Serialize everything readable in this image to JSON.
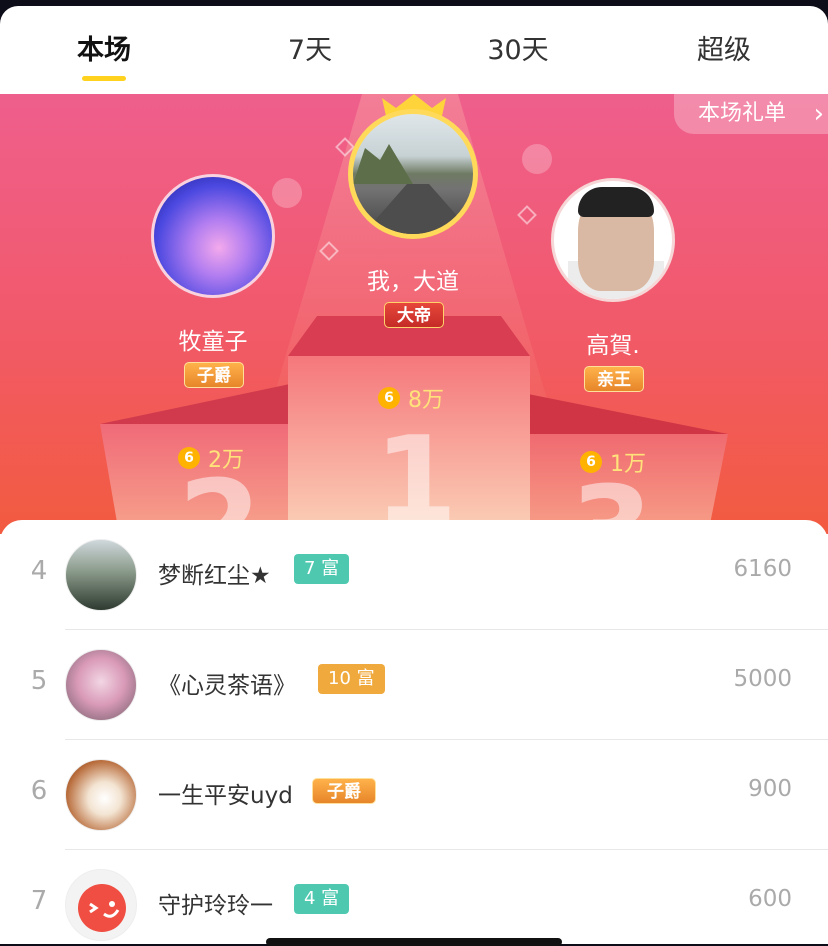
{
  "tabs": [
    "本场",
    "7天",
    "30天",
    "超级"
  ],
  "gift_link": "本场礼单",
  "podium": {
    "first": {
      "name": "我，大道",
      "title": "大帝",
      "value": "8万",
      "rank": "1"
    },
    "second": {
      "name": "牧童子",
      "title": "子爵",
      "value": "2万",
      "rank": "2"
    },
    "third": {
      "name": "高賀.",
      "title": "亲王",
      "value": "1万",
      "rank": "3"
    }
  },
  "coin_symbol": "6",
  "ranking": [
    {
      "rank": "4",
      "name": "梦断红尘★",
      "level": "7 富",
      "score": "6160"
    },
    {
      "rank": "5",
      "name": "《心灵茶语》",
      "level": "10 富",
      "score": "5000"
    },
    {
      "rank": "6",
      "name": "一生平安uyd",
      "level": "子爵",
      "score": "900"
    },
    {
      "rank": "7",
      "name": "守护玲玲一",
      "level": "4 富",
      "score": "600"
    }
  ],
  "colors": {
    "accent": "#ffd21f",
    "hero_top": "#ef5f8d",
    "hero_bottom": "#f25b3f",
    "teal_badge": "#4ec9b0",
    "orange_badge": "#f0a93c"
  }
}
